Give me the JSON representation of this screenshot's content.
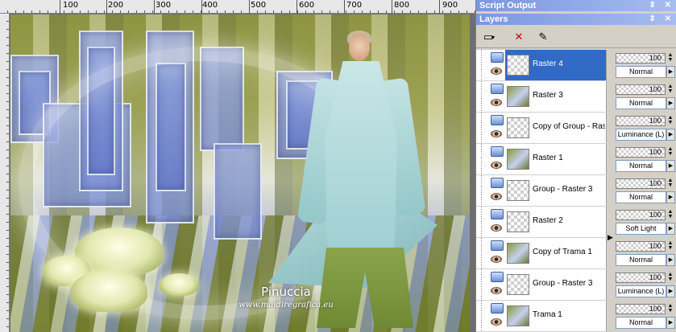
{
  "ruler": {
    "labels": [
      "100",
      "200",
      "300",
      "400",
      "500",
      "600",
      "700",
      "800",
      "900"
    ]
  },
  "watermark": {
    "signature": "Pinuccia",
    "url": "www.maidiregrafica.eu"
  },
  "script_output": {
    "title": "Script Output",
    "window_buttons": "⇕ ✕"
  },
  "layers_palette": {
    "title": "Layers",
    "window_buttons": "⇕ ✕",
    "toolbar_icons": [
      "new-layer-icon",
      "delete-layer-icon",
      "edit-selection-icon"
    ],
    "layers": [
      {
        "name": "Raster 4",
        "selected": true,
        "opacity": "100",
        "blend": "Normal"
      },
      {
        "name": "Raster 3",
        "selected": false,
        "opacity": "100",
        "blend": "Normal"
      },
      {
        "name": "Copy of Group - Rast",
        "selected": false,
        "opacity": "100",
        "blend": "Luminance (L)"
      },
      {
        "name": "Raster 1",
        "selected": false,
        "opacity": "100",
        "blend": "Normal"
      },
      {
        "name": "Group - Raster 3",
        "selected": false,
        "opacity": "100",
        "blend": "Normal"
      },
      {
        "name": "Raster 2",
        "selected": false,
        "opacity": "100",
        "blend": "Soft Light"
      },
      {
        "name": "Copy of Trama 1",
        "selected": false,
        "opacity": "100",
        "blend": "Normal"
      },
      {
        "name": "Group - Raster 3",
        "selected": false,
        "opacity": "100",
        "blend": "Luminance (L)"
      },
      {
        "name": "Trama 1",
        "selected": false,
        "opacity": "100",
        "blend": "Normal"
      }
    ]
  }
}
